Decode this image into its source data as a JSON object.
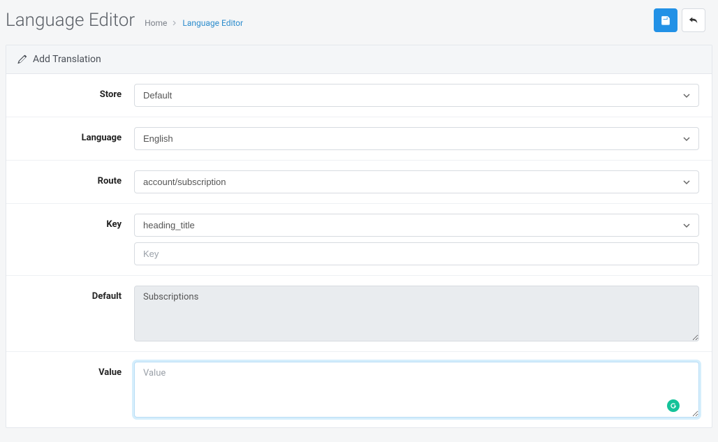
{
  "header": {
    "title": "Language Editor",
    "breadcrumb": {
      "home": "Home",
      "current": "Language Editor"
    }
  },
  "panel": {
    "title": "Add Translation"
  },
  "form": {
    "store": {
      "label": "Store",
      "value": "Default"
    },
    "language": {
      "label": "Language",
      "value": "English"
    },
    "route": {
      "label": "Route",
      "value": "account/subscription"
    },
    "key": {
      "label": "Key",
      "select_value": "heading_title",
      "input_placeholder": "Key",
      "input_value": ""
    },
    "default": {
      "label": "Default",
      "value": "Subscriptions"
    },
    "value": {
      "label": "Value",
      "placeholder": "Value",
      "value": ""
    }
  }
}
